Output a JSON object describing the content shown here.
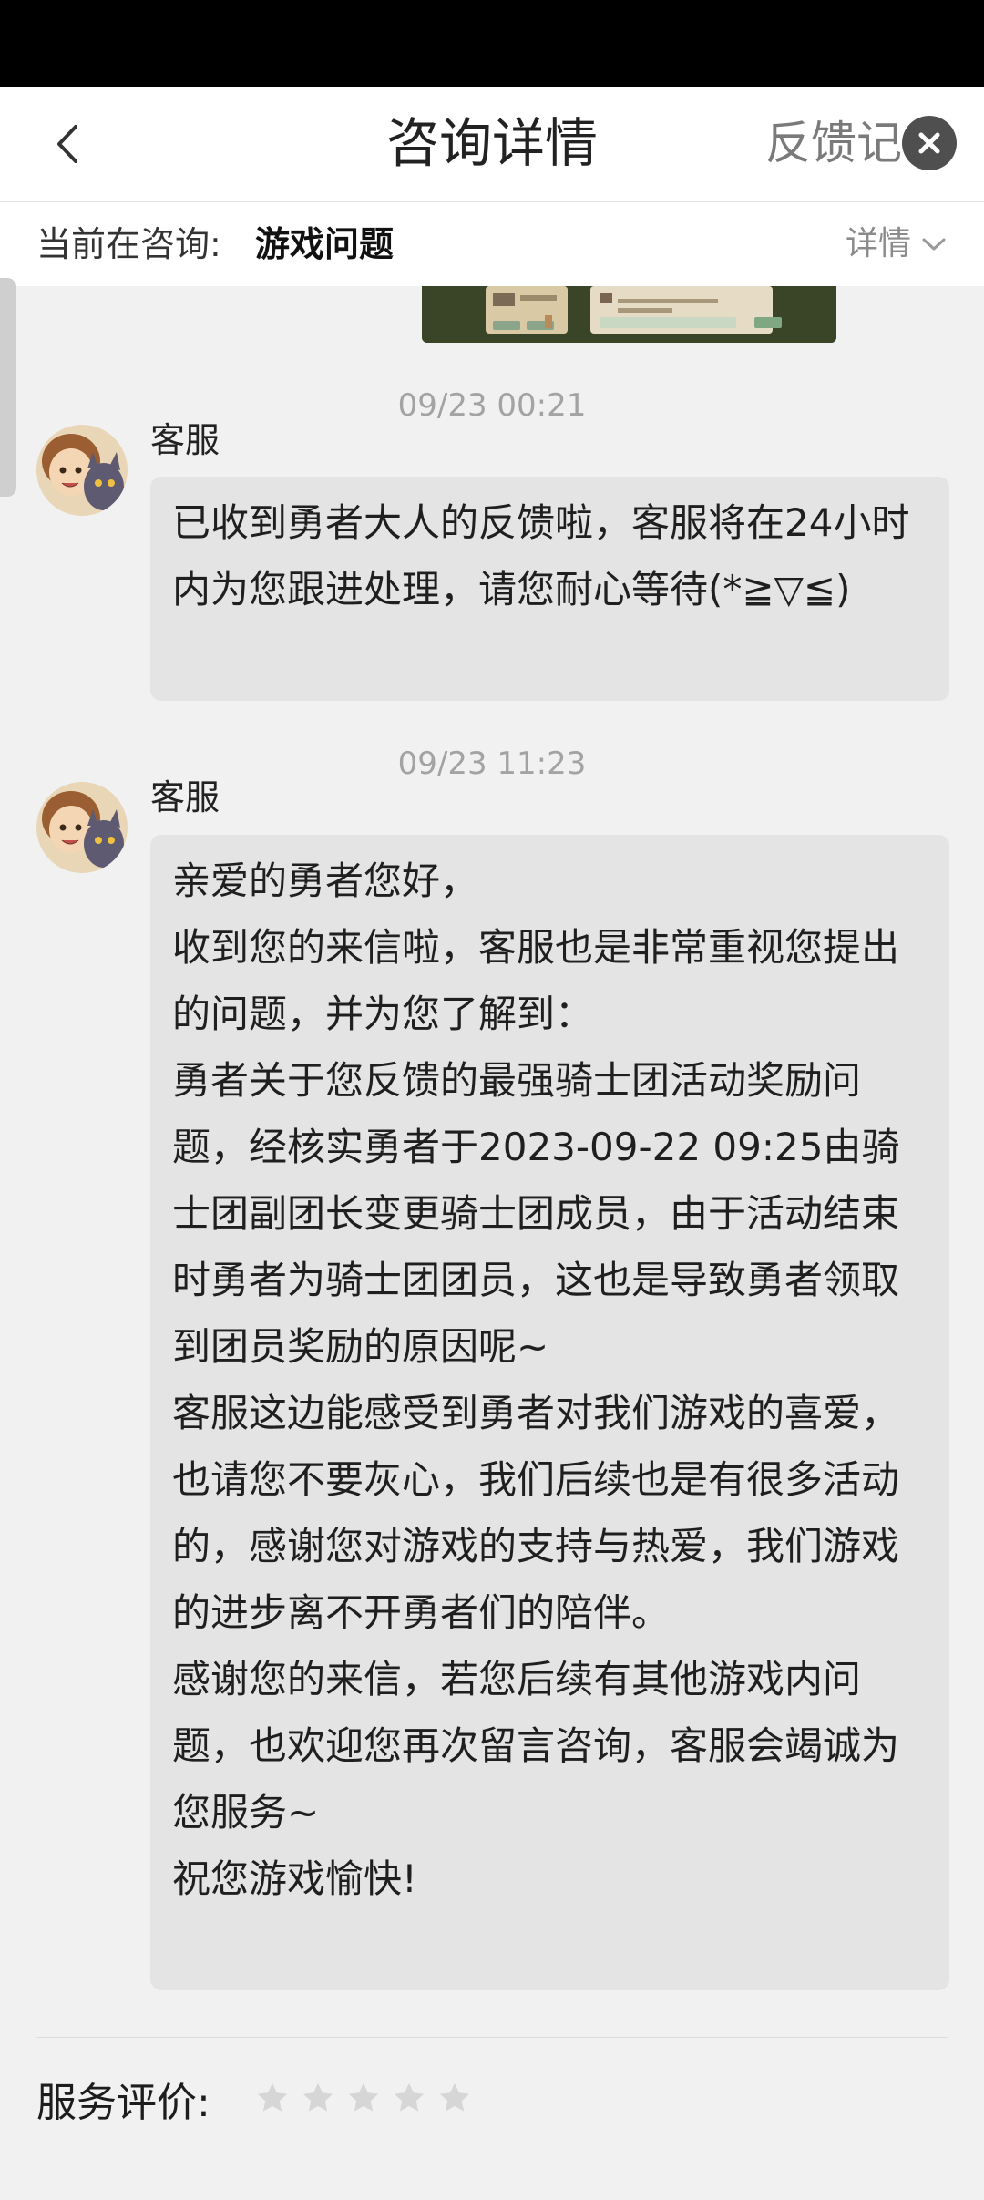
{
  "header": {
    "title": "咨询详情",
    "feedback_link": "反馈记"
  },
  "consult": {
    "label": "当前在咨询:",
    "topic": "游戏问题",
    "detail_toggle": "详情"
  },
  "messages": [
    {
      "time": "09/23 00:21",
      "sender": "客服",
      "text": "已收到勇者大人的反馈啦，客服将在24小时内为您跟进处理，请您耐心等待(*≧▽≦)"
    },
    {
      "time": "09/23 11:23",
      "sender": "客服",
      "lines": [
        "亲爱的勇者您好，",
        "收到您的来信啦，客服也是非常重视您提出的问题，并为您了解到：",
        "勇者关于您反馈的最强骑士团活动奖励问题，经核实勇者于2023-09-22 09:25由骑士团副团长变更骑士团成员，由于活动结束时勇者为骑士团团员，这也是导致勇者领取到团员奖励的原因呢~",
        "客服这边能感受到勇者对我们游戏的喜爱，也请您不要灰心，我们后续也是有很多活动的，感谢您对游戏的支持与热爱，我们游戏的进步离不开勇者们的陪伴。",
        "感谢您的来信，若您后续有其他游戏内问题，也欢迎您再次留言咨询，客服会竭诚为您服务~",
        "祝您游戏愉快!"
      ]
    }
  ],
  "rating": {
    "label": "服务评价:",
    "stars": 0,
    "max": 5
  },
  "colors": {
    "bubble": "#e4e4e4",
    "background": "#f1f1f1",
    "star_empty": "#d6d6d6"
  }
}
